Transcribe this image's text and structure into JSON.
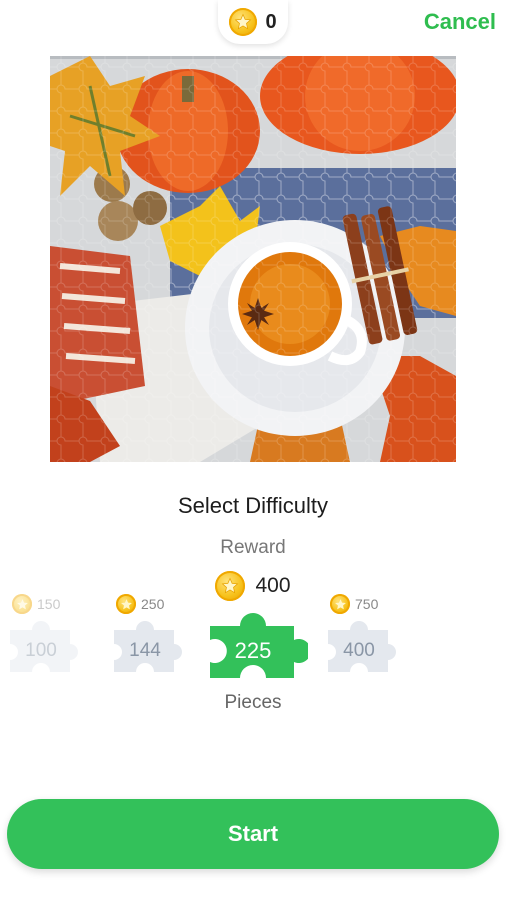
{
  "header": {
    "coin_count": "0",
    "cancel_label": "Cancel"
  },
  "puzzle": {
    "image_icon": "autumn-tea-puzzle-image"
  },
  "difficulty": {
    "title": "Select Difficulty",
    "reward_label": "Reward",
    "reward_value": "400",
    "pieces_label": "Pieces",
    "options": [
      {
        "pieces": "100",
        "reward": "150"
      },
      {
        "pieces": "144",
        "reward": "250"
      },
      {
        "pieces": "225",
        "reward": ""
      },
      {
        "pieces": "400",
        "reward": "750"
      }
    ]
  },
  "start_label": "Start",
  "colors": {
    "accent": "#33c15a",
    "cancel": "#2fbd4f",
    "piece_inactive": "#e4e8ee"
  }
}
